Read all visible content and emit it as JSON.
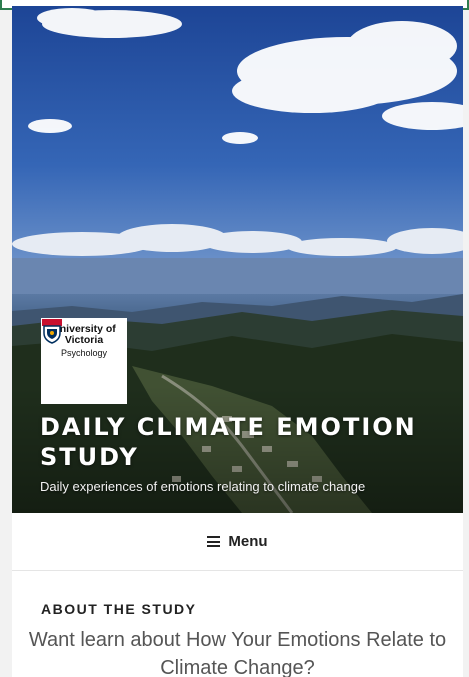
{
  "header": {
    "logo": {
      "university": "University of Victoria",
      "department": "Psychology"
    },
    "site_title": "DAILY CLIMATE EMOTION STUDY",
    "tagline": "Daily experiences of emotions relating to climate change"
  },
  "navigation": {
    "menu_icon": "hamburger-icon",
    "menu_label": "Menu"
  },
  "content": {
    "section_heading": "ABOUT THE STUDY",
    "intro_text": "Want learn about How Your Emotions Relate to Climate Change?"
  },
  "colors": {
    "accent_border": "#2e7d4f",
    "sky": "#2a56a8",
    "forest": "#1f2e1c"
  }
}
